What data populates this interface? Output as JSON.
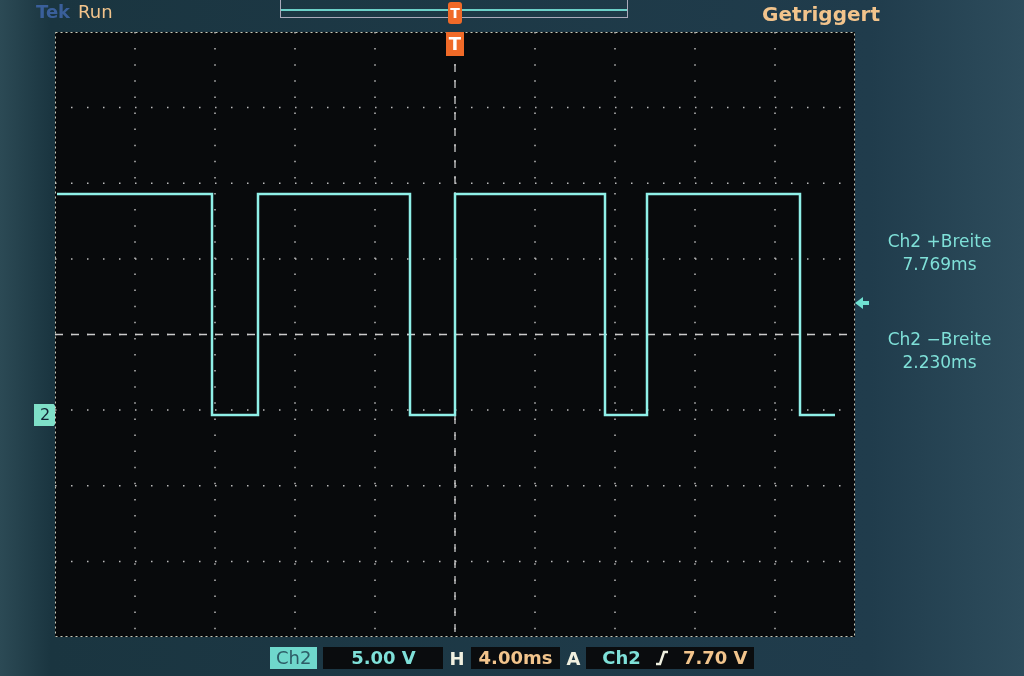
{
  "top_bar": {
    "brand": "Tek",
    "run_state": "Run",
    "trigger_marker": "T",
    "trigger_status": "Getriggert"
  },
  "graticule": {
    "trigger_position_marker": "T",
    "channel_marker": "2"
  },
  "measurements": [
    {
      "label": "Ch2 +Breite",
      "value": "7.769ms"
    },
    {
      "label": "Ch2 −Breite",
      "value": "2.230ms"
    }
  ],
  "bottom_bar": {
    "channel": "Ch2",
    "volts_per_div": "5.00 V",
    "horizontal_label": "H",
    "time_per_div": "4.00ms",
    "trigger_mode": "A",
    "trigger_source": "Ch2",
    "trigger_slope_rising": true,
    "trigger_level": "7.70 V"
  }
}
